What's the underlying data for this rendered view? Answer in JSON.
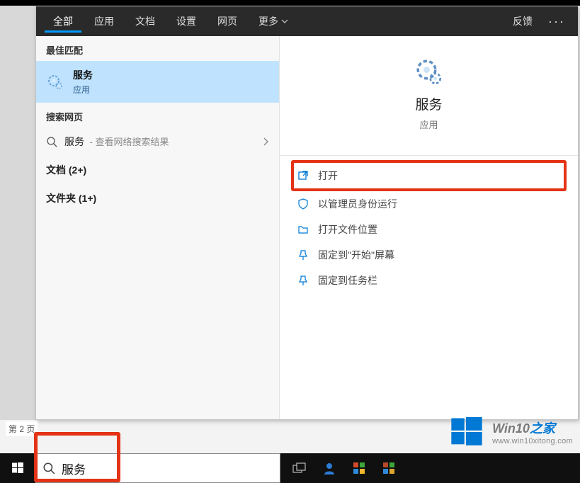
{
  "tabs": {
    "all": "全部",
    "apps": "应用",
    "docs": "文档",
    "settings": "设置",
    "web": "网页",
    "more": "更多",
    "feedback": "反馈"
  },
  "sections": {
    "best_match": "最佳匹配",
    "search_web": "搜索网页",
    "docs_cat": "文档 (2+)",
    "folders_cat": "文件夹 (1+)"
  },
  "best_match": {
    "title": "服务",
    "subtitle": "应用"
  },
  "web_result": {
    "term": "服务",
    "hint": " - 查看网络搜索结果"
  },
  "right": {
    "title": "服务",
    "subtitle": "应用"
  },
  "actions": {
    "open": "打开",
    "run_admin": "以管理员身份运行",
    "open_location": "打开文件位置",
    "pin_start": "固定到\"开始\"屏幕",
    "pin_taskbar": "固定到任务栏"
  },
  "search": {
    "value": "服务"
  },
  "page_hint": "第 2 页",
  "watermark": {
    "brand1": "Win10",
    "brand2": "之家",
    "url": "www.win10xitong.com"
  }
}
